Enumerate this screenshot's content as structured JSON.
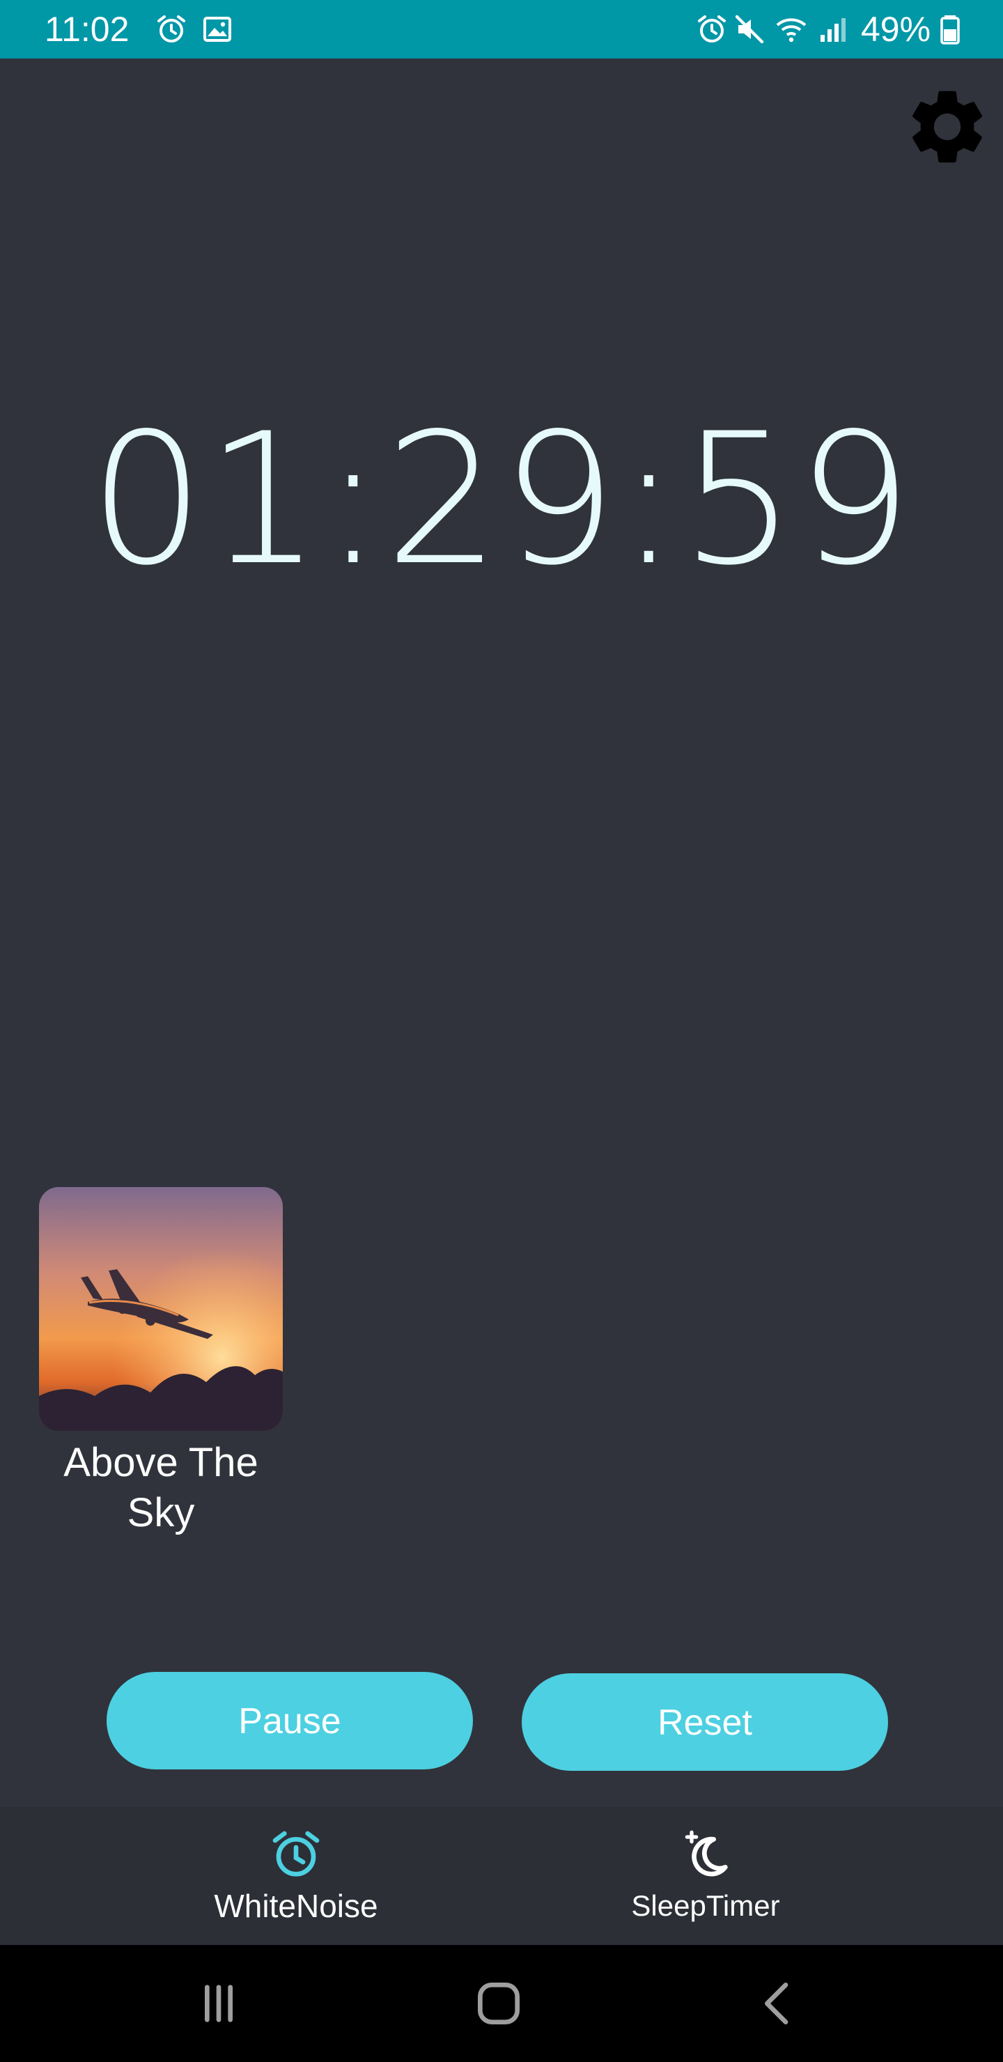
{
  "status_bar": {
    "time": "11:02",
    "battery": "49%",
    "icons": [
      "alarm-icon",
      "image-icon",
      "alarm-icon",
      "mute-icon",
      "wifi-icon",
      "signal-icon",
      "battery-icon"
    ]
  },
  "settings": {
    "icon": "gear-icon"
  },
  "timer": {
    "display": "01:29:59"
  },
  "sound": {
    "title": "Above The Sky",
    "thumbnail": "airplane-sunset-image"
  },
  "controls": {
    "pause_label": "Pause",
    "reset_label": "Reset"
  },
  "bottom_nav": {
    "items": [
      {
        "label": "WhiteNoise",
        "icon": "alarm-clock-icon",
        "active": true
      },
      {
        "label": "SleepTimer",
        "icon": "moon-star-icon",
        "active": false
      }
    ]
  },
  "system_nav": {
    "buttons": [
      "recent-apps-icon",
      "home-icon",
      "back-icon"
    ]
  },
  "colors": {
    "status_bar": "#0097a7",
    "background": "#30333b",
    "accent": "#4dd0e1",
    "timer_text": "#e6fafc",
    "nav_bar": "#2c2f36"
  }
}
